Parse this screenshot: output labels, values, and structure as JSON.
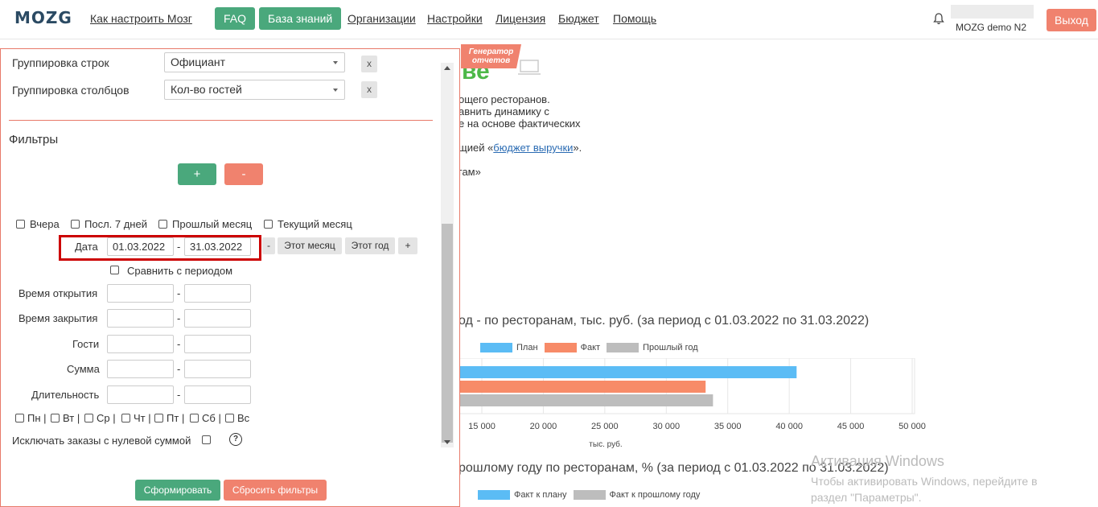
{
  "nav": {
    "logo": "MOZG",
    "links": [
      "Как настроить Мозг",
      "Организации",
      "Настройки",
      "Лицензия",
      "Бюджет",
      "Помощь"
    ],
    "faq": "FAQ",
    "kb": "База знаний",
    "user_name": "MOZG demo N2",
    "logout": "Выход"
  },
  "background": {
    "badge": "Генератор отчетов",
    "line1": "ощего ресторанов.",
    "line2": "авнить динамику с",
    "line3": "е на основе фактических",
    "line4_pre": "щией «",
    "line4_link": "бюджет выручки",
    "line4_post": "».",
    "line5": "гам»",
    "chart1_title": "од - по ресторанам, тыс. руб. (за период с 01.03.2022 по 31.03.2022)",
    "chart2_title": "рошлому году по ресторанам, % (за период с 01.03.2022 по 31.03.2022)",
    "legend1": [
      "План",
      "Факт",
      "Прошлый год"
    ],
    "legend2": [
      "Факт к плану",
      "Факт к прошлому году"
    ],
    "xaxis_label": "тыс. руб.",
    "watermark_title": "Активация Windows",
    "watermark_line1": "Чтобы активировать Windows, перейдите в",
    "watermark_line2": "раздел \"Параметры\"."
  },
  "chart_data": {
    "type": "bar",
    "orientation": "horizontal",
    "title": "од - по ресторанам, тыс. руб. (за период с 01.03.2022 по 31.03.2022)",
    "xlabel": "тыс. руб.",
    "xticks": [
      "15 000",
      "20 000",
      "25 000",
      "30 000",
      "35 000",
      "40 000",
      "45 000",
      "50 000"
    ],
    "xlim": [
      15000,
      50000
    ],
    "series": [
      {
        "name": "План",
        "color": "#5bbcf5",
        "value": 40600
      },
      {
        "name": "Факт",
        "color": "#f78b68",
        "value": 33200
      },
      {
        "name": "Прошлый год",
        "color": "#bdbdbd",
        "value": 33800
      }
    ],
    "grid": true,
    "legend": "top"
  },
  "filters": {
    "row_group_label": "Группировка строк",
    "row_group_value": "Официант",
    "col_group_label": "Группировка столбцов",
    "col_group_value": "Кол-во гостей",
    "remove": "x",
    "title": "Фильтры",
    "add": "+",
    "minus": "-",
    "quick": [
      "Вчера",
      "Посл. 7 дней",
      "Прошлый месяц",
      "Текущий месяц"
    ],
    "date_label": "Дата",
    "date_from": "01.03.2022",
    "date_to": "31.03.2022",
    "date_prev": "-",
    "this_month": "Этот месяц",
    "this_year": "Этот год",
    "date_next": "+",
    "compare": "Сравнить с периодом",
    "open_time": "Время открытия",
    "close_time": "Время закрытия",
    "guests": "Гости",
    "sum": "Сумма",
    "duration": "Длительность",
    "dash": "-",
    "days": [
      "Пн",
      "Вт",
      "Ср",
      "Чт",
      "Пт",
      "Сб",
      "Вс"
    ],
    "sep": "|",
    "exclude_zero": "Исключать заказы с нулевой суммой",
    "help": "?",
    "build": "Сформировать",
    "reset": "Сбросить фильтры"
  },
  "colors": {
    "green": "#4aa87c",
    "salmon": "#f0826e",
    "plan": "#5bbcf5",
    "fact": "#f78b68",
    "last_year": "#bdbdbd"
  }
}
